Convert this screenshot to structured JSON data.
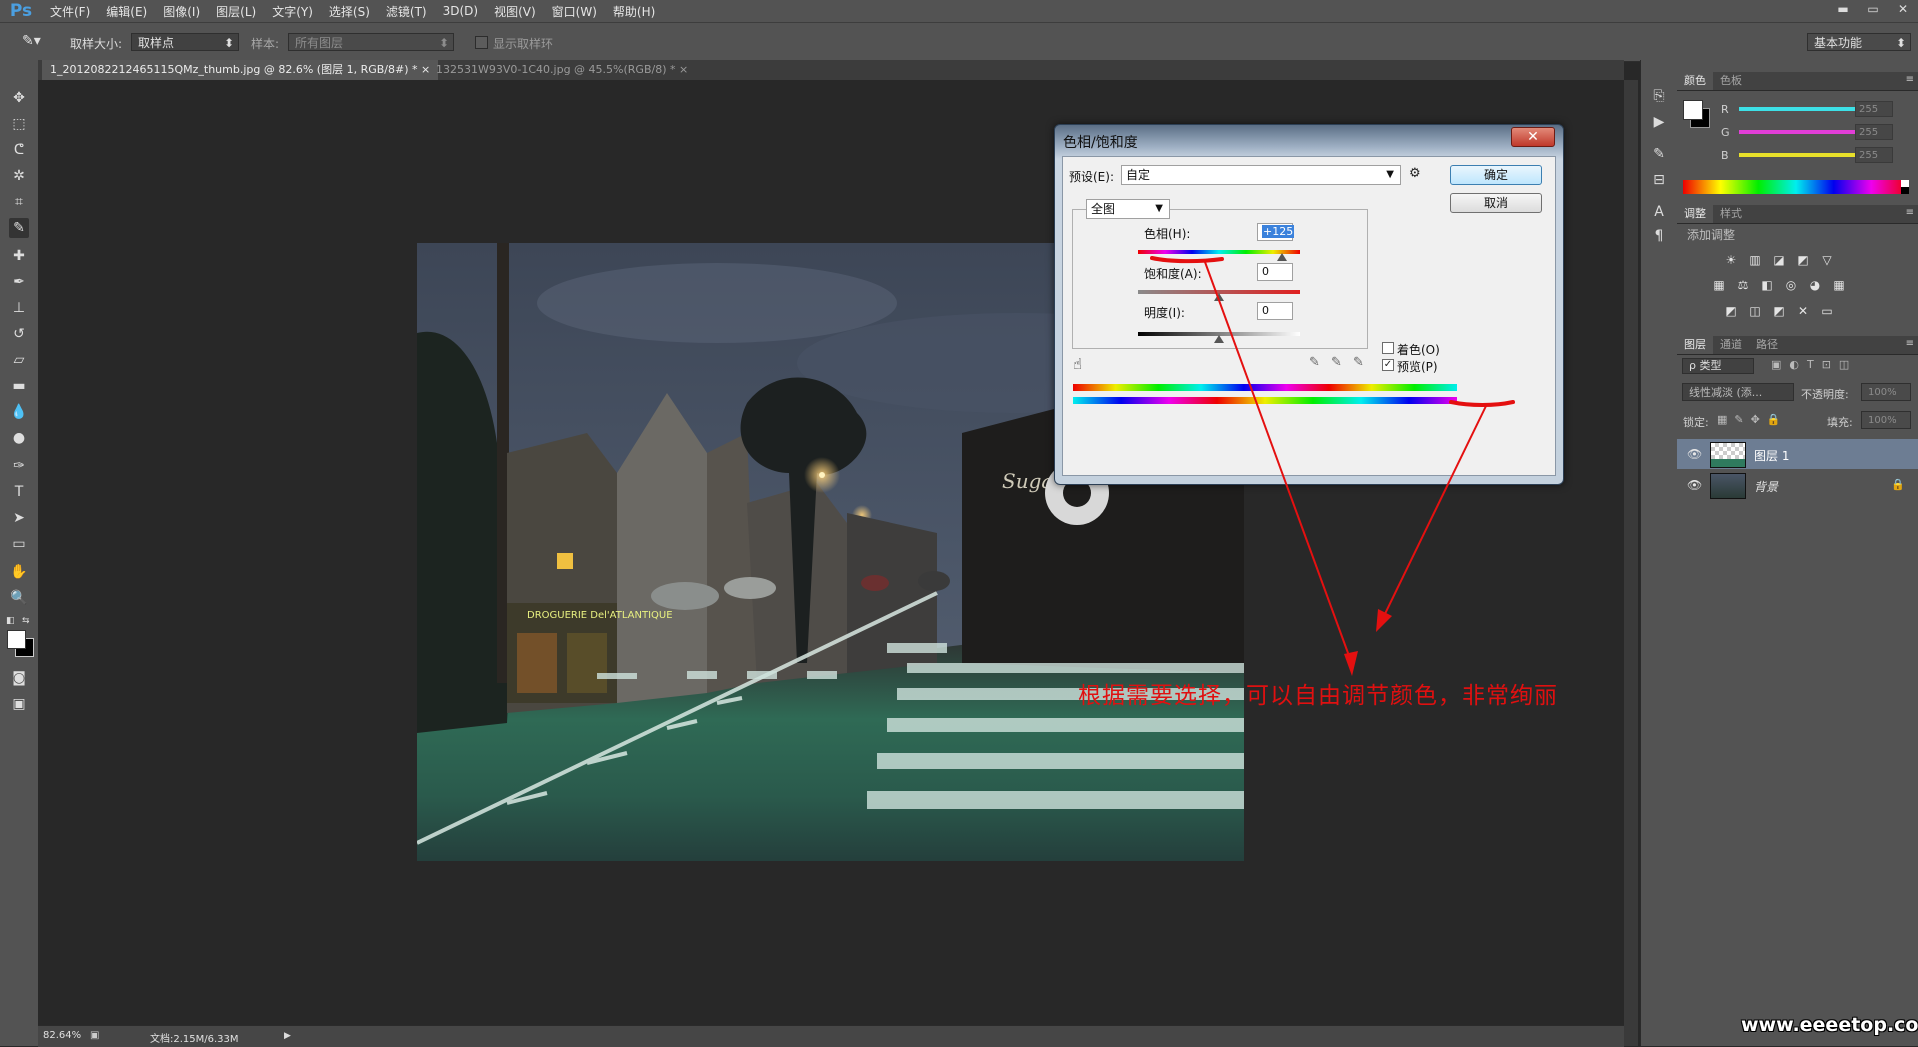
{
  "app": {
    "logo": "Ps"
  },
  "menu": [
    "文件(F)",
    "编辑(E)",
    "图像(I)",
    "图层(L)",
    "文字(Y)",
    "选择(S)",
    "滤镜(T)",
    "3D(D)",
    "视图(V)",
    "窗口(W)",
    "帮助(H)"
  ],
  "window_buttons": {
    "minimize": "▬",
    "restore": "▭",
    "close": "✕"
  },
  "options": {
    "sample_size_label": "取样大小:",
    "sample_size_value": "取样点",
    "sample_label": "样本:",
    "sample_value": "所有图层",
    "show_ring_label": "显示取样环",
    "workspace": "基本功能"
  },
  "tabs": [
    {
      "label": "1_2012082212465115QMz_thumb.jpg @ 82.6% (图层 1, RGB/8#) *",
      "close": "×"
    },
    {
      "label": "132531W93V0-1C40.jpg @ 45.5%(RGB/8) *",
      "close": "×"
    }
  ],
  "status": {
    "zoom": "82.64%",
    "doc": "文档:2.15M/6.33M",
    "arrow": "▶"
  },
  "color_panel": {
    "tabs": [
      "颜色",
      "色板"
    ],
    "channels": [
      {
        "label": "R",
        "value": "255"
      },
      {
        "label": "G",
        "value": "255"
      },
      {
        "label": "B",
        "value": "255"
      }
    ],
    "colors": {
      "r": "#3de0e6",
      "g": "#e23ed8",
      "b": "#e8e02a"
    }
  },
  "adjust_panel": {
    "tabs": [
      "调整",
      "样式"
    ],
    "title": "添加调整",
    "row1": [
      "☀",
      "▥",
      "◪",
      "◩",
      "▽"
    ],
    "row2": [
      "▦",
      "⚖",
      "◧",
      "◎",
      "◕",
      "▦"
    ],
    "row3": [
      "◩",
      "◫",
      "◩",
      "✕",
      "▭"
    ]
  },
  "layers_panel": {
    "tabs": [
      "图层",
      "通道",
      "路径"
    ],
    "filter_label": "ρ 类型",
    "blend_mode": "线性减淡 (添...",
    "opacity_label": "不透明度:",
    "opacity_value": "100%",
    "lock_label": "锁定:",
    "fill_label": "填充:",
    "fill_value": "100%",
    "layers": [
      {
        "name": "图层 1",
        "selected": true
      },
      {
        "name": "背景",
        "selected": false
      }
    ]
  },
  "dialog": {
    "title": "色相/饱和度",
    "close": "✕",
    "preset_label": "预设(E):",
    "preset_value": "自定",
    "ok": "确定",
    "cancel": "取消",
    "channel": "全图",
    "hue_label": "色相(H):",
    "hue_value": "+125",
    "sat_label": "饱和度(A):",
    "sat_value": "0",
    "light_label": "明度(I):",
    "light_value": "0",
    "colorize_label": "着色(O)",
    "colorize_checked": false,
    "preview_label": "预览(P)",
    "preview_checked": true,
    "hue_pct": 0.89,
    "sat_pct": 0.5,
    "light_pct": 0.5
  },
  "annotation": "根据需要选择，可以自由调节颜色，非常绚丽",
  "watermark": "www.eeeetop.com",
  "photo_signs": {
    "shop": "DROGUERIE Del'ATLANTIQUE",
    "cafe": "Suga"
  }
}
